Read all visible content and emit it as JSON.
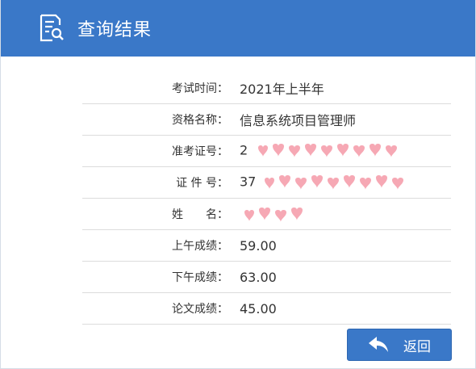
{
  "header": {
    "title": "查询结果",
    "icon": "document-search-icon"
  },
  "rows": [
    {
      "label": "考试时间：",
      "value": "2021年上半年"
    },
    {
      "label": "资格名称：",
      "value": "信息系统项目管理师"
    },
    {
      "label": "准考证号：",
      "value": "2"
    },
    {
      "label": "证 件 号：",
      "value": "37"
    },
    {
      "label": "姓　　名：",
      "value": ""
    },
    {
      "label": "上午成绩：",
      "value": "59.00"
    },
    {
      "label": "下午成绩：",
      "value": "63.00"
    },
    {
      "label": "论文成绩：",
      "value": "45.00"
    }
  ],
  "back_button": {
    "label": "返回",
    "icon": "back-arrow-icon"
  },
  "colors": {
    "header": "#3a78c8",
    "mask": "#f6a8b4"
  }
}
